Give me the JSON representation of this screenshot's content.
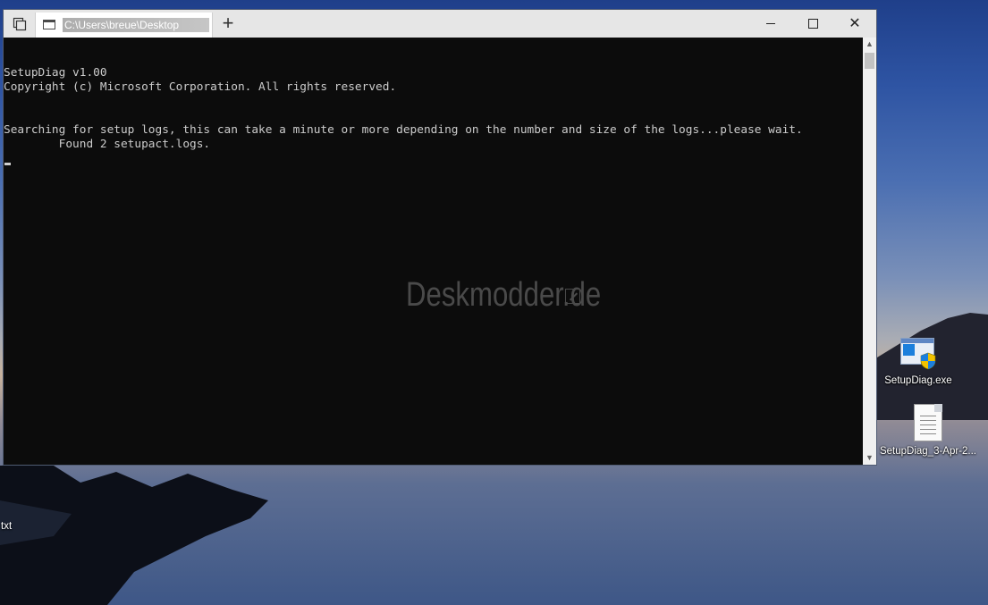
{
  "window": {
    "tab_title": "C:\\Users\\breue\\Desktop",
    "new_tab_symbol": "+",
    "close_symbol": "✕"
  },
  "console": {
    "lines": [
      "SetupDiag v1.00",
      "Copyright (c) Microsoft Corporation. All rights reserved.",
      "",
      "",
      "Searching for setup logs, this can take a minute or more depending on the number and size of the logs...please wait.",
      "        Found 2 setupact.logs."
    ],
    "watermark": "Deskmodder.de"
  },
  "scrollbar": {
    "up_arrow": "▲",
    "down_arrow": "▼"
  },
  "desktop": {
    "icons": [
      {
        "label": "SetupDiag.exe",
        "icon": "setupdiag-exe-icon"
      },
      {
        "label": "SetupDiag_3-Apr-2...",
        "icon": "text-file-icon"
      }
    ],
    "partial_label": "txt"
  },
  "colors": {
    "console_bg": "#0c0c0c",
    "console_fg": "#cccccc",
    "titlebar": "#e6e6e6"
  }
}
